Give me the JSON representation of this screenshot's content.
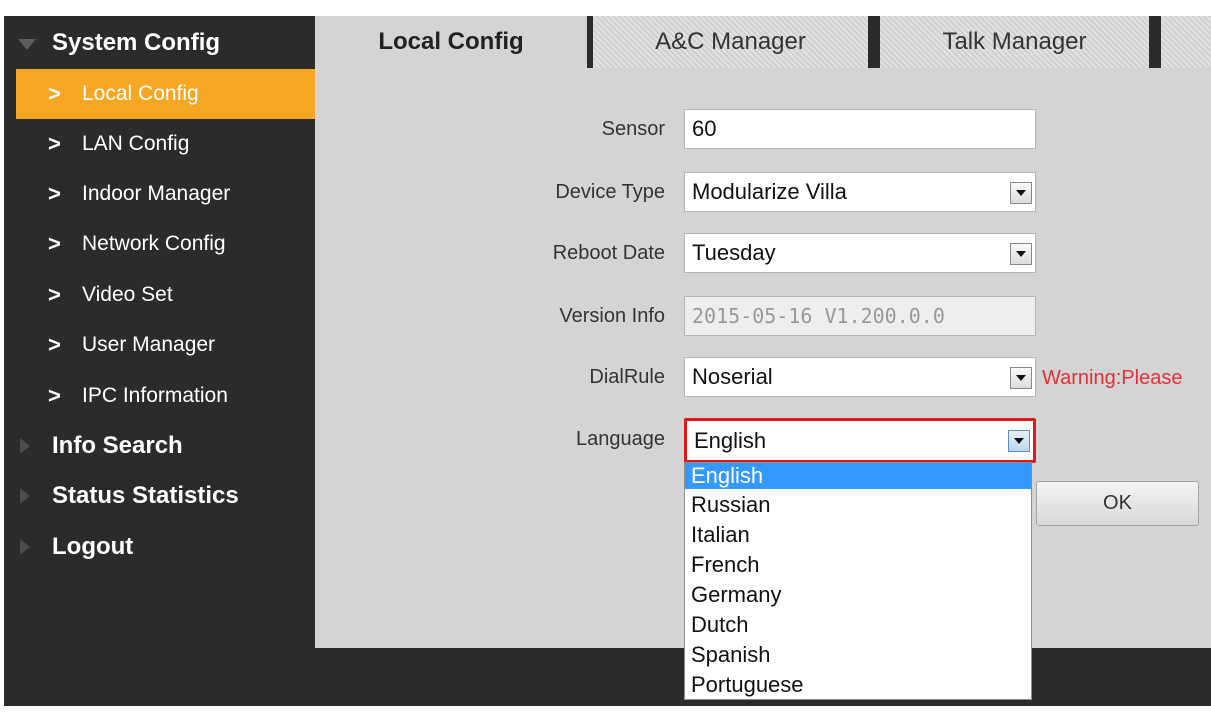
{
  "sidebar": {
    "sections": [
      {
        "label": "System Config",
        "expanded": true
      },
      {
        "label": "Info Search",
        "expanded": false
      },
      {
        "label": "Status Statistics",
        "expanded": false
      },
      {
        "label": "Logout",
        "expanded": false
      }
    ],
    "items": [
      {
        "label": "Local Config",
        "active": true
      },
      {
        "label": "LAN Config"
      },
      {
        "label": "Indoor Manager"
      },
      {
        "label": "Network Config"
      },
      {
        "label": "Video Set"
      },
      {
        "label": "User Manager"
      },
      {
        "label": "IPC Information"
      }
    ]
  },
  "tabs": [
    {
      "label": "Local Config",
      "active": true
    },
    {
      "label": "A&C Manager"
    },
    {
      "label": "Talk Manager"
    }
  ],
  "form": {
    "sensor": {
      "label": "Sensor",
      "value": "60"
    },
    "device_type": {
      "label": "Device Type",
      "value": "Modularize Villa"
    },
    "reboot_date": {
      "label": "Reboot Date",
      "value": "Tuesday"
    },
    "version_info": {
      "label": "Version Info",
      "value": "2015-05-16 V1.200.0.0"
    },
    "dial_rule": {
      "label": "DialRule",
      "value": "Noserial",
      "warning": "Warning:Please"
    },
    "language": {
      "label": "Language",
      "value": "English"
    }
  },
  "language_options": [
    "English",
    "Russian",
    "Italian",
    "French",
    "Germany",
    "Dutch",
    "Spanish",
    "Portuguese"
  ],
  "ok_label": "OK",
  "colors": {
    "active_item": "#f5a623",
    "sidebar_bg": "#2b2b2b",
    "content_bg": "#d4d4d4",
    "highlight": "#e01818",
    "selected_option": "#3399ff",
    "warning": "#e0313b"
  }
}
